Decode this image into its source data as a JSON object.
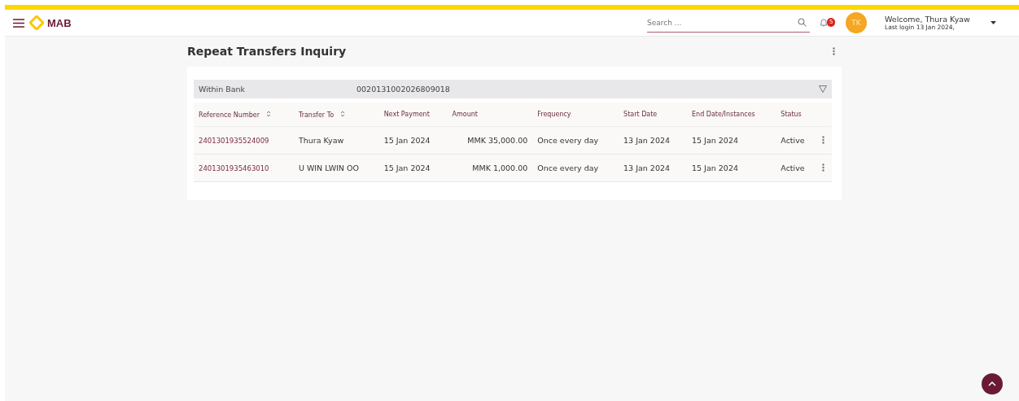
{
  "header": {
    "logo": "MAB",
    "search": {
      "placeholder": "Search ..."
    },
    "notifications": "5",
    "avatar": "TK",
    "welcome": "Welcome, Thura Kyaw",
    "last_login": "Last login 13 Jan 2024,"
  },
  "page": {
    "title": "Repeat Transfers Inquiry"
  },
  "group": {
    "label": "Within Bank",
    "account": "0020131002026809018"
  },
  "table": {
    "columns": [
      {
        "label": "Reference Number",
        "sortable": true
      },
      {
        "label": "Transfer To",
        "sortable": true
      },
      {
        "label": "Next Payment",
        "sortable": false
      },
      {
        "label": "Amount",
        "sortable": false
      },
      {
        "label": "Frequency",
        "sortable": false
      },
      {
        "label": "Start Date",
        "sortable": false
      },
      {
        "label": "End Date/Instances",
        "sortable": false
      },
      {
        "label": "Status",
        "sortable": false
      }
    ],
    "rows": [
      [
        "2401301935524009",
        "Thura Kyaw",
        "15 Jan 2024",
        "MMK 35,000.00",
        "Once every day",
        "13 Jan 2024",
        "15 Jan 2024",
        "Active"
      ],
      [
        "2401301935463010",
        "U WIN LWIN OO",
        "15 Jan 2024",
        "MMK 1,000.00",
        "Once every day",
        "13 Jan 2024",
        "15 Jan 2024",
        "Active"
      ]
    ]
  }
}
